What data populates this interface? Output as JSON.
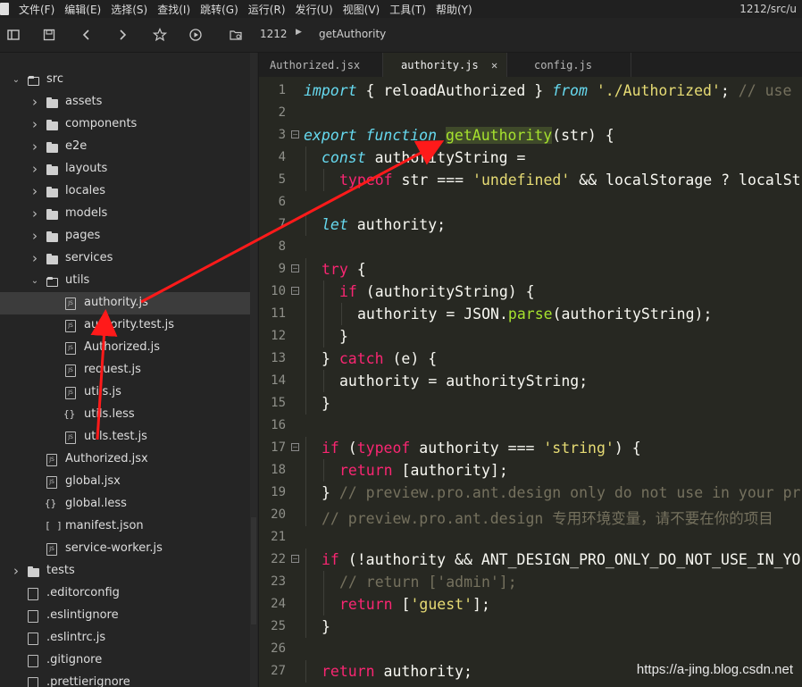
{
  "menubar": {
    "items": [
      "文件(F)",
      "编辑(E)",
      "选择(S)",
      "查找(I)",
      "跳转(G)",
      "运行(R)",
      "发行(U)",
      "视图(V)",
      "工具(T)",
      "帮助(Y)"
    ],
    "title_path": "1212/src/u"
  },
  "toolbar": {
    "project": "1212",
    "breadcrumb": "getAuthority"
  },
  "sidebar": {
    "items": [
      {
        "label": "src",
        "type": "folder-open"
      },
      {
        "label": "assets",
        "type": "folder"
      },
      {
        "label": "components",
        "type": "folder"
      },
      {
        "label": "e2e",
        "type": "folder"
      },
      {
        "label": "layouts",
        "type": "folder"
      },
      {
        "label": "locales",
        "type": "folder"
      },
      {
        "label": "models",
        "type": "folder"
      },
      {
        "label": "pages",
        "type": "folder"
      },
      {
        "label": "services",
        "type": "folder"
      },
      {
        "label": "utils",
        "type": "folder-open"
      },
      {
        "label": "authority.js",
        "type": "js"
      },
      {
        "label": "authority.test.js",
        "type": "js"
      },
      {
        "label": "Authorized.js",
        "type": "js"
      },
      {
        "label": "request.js",
        "type": "js"
      },
      {
        "label": "utils.js",
        "type": "js"
      },
      {
        "label": "utils.less",
        "type": "less"
      },
      {
        "label": "utils.test.js",
        "type": "js"
      },
      {
        "label": "Authorized.jsx",
        "type": "js"
      },
      {
        "label": "global.jsx",
        "type": "js"
      },
      {
        "label": "global.less",
        "type": "less"
      },
      {
        "label": "manifest.json",
        "type": "json"
      },
      {
        "label": "service-worker.js",
        "type": "js"
      },
      {
        "label": "tests",
        "type": "folder"
      },
      {
        "label": ".editorconfig",
        "type": "file"
      },
      {
        "label": ".eslintignore",
        "type": "file"
      },
      {
        "label": ".eslintrc.js",
        "type": "file"
      },
      {
        "label": ".gitignore",
        "type": "file"
      },
      {
        "label": ".prettierignore",
        "type": "file"
      }
    ]
  },
  "tabs": [
    {
      "label": "Authorized.jsx"
    },
    {
      "label": "authority.js"
    },
    {
      "label": "config.js"
    }
  ],
  "tab_close": "✕",
  "editor": {
    "line_numbers": [
      "1",
      "2",
      "3",
      "4",
      "5",
      "6",
      "7",
      "8",
      "9",
      "10",
      "11",
      "12",
      "13",
      "14",
      "15",
      "16",
      "17",
      "18",
      "19",
      "20",
      "21",
      "22",
      "23",
      "24",
      "25",
      "26",
      "27"
    ],
    "lines": [
      {
        "indent": 0,
        "tokens": [
          [
            "st",
            "import"
          ],
          [
            "p",
            " { reloadAuthorized } "
          ],
          [
            "st",
            "from"
          ],
          [
            "p",
            " "
          ],
          [
            "str",
            "'./Authorized'"
          ],
          [
            "p",
            "; "
          ],
          [
            "cm",
            "// use"
          ]
        ]
      },
      {
        "indent": 0,
        "tokens": []
      },
      {
        "indent": 0,
        "tokens": [
          [
            "st",
            "export"
          ],
          [
            "p",
            " "
          ],
          [
            "st",
            "function"
          ],
          [
            "p",
            " "
          ],
          [
            "hl",
            "getAuthority"
          ],
          [
            "p",
            "(str) {"
          ]
        ]
      },
      {
        "indent": 1,
        "tokens": [
          [
            "st",
            "const"
          ],
          [
            "p",
            " authorityString ="
          ]
        ]
      },
      {
        "indent": 2,
        "tokens": [
          [
            "kw",
            "typeof"
          ],
          [
            "p",
            " str === "
          ],
          [
            "str",
            "'undefined'"
          ],
          [
            "p",
            " && localStorage ? localSt"
          ]
        ]
      },
      {
        "indent": 0,
        "tokens": []
      },
      {
        "indent": 1,
        "tokens": [
          [
            "st",
            "let"
          ],
          [
            "p",
            " authority;"
          ]
        ]
      },
      {
        "indent": 0,
        "tokens": []
      },
      {
        "indent": 1,
        "tokens": [
          [
            "kw",
            "try"
          ],
          [
            "p",
            " {"
          ]
        ]
      },
      {
        "indent": 2,
        "tokens": [
          [
            "kw",
            "if"
          ],
          [
            "p",
            " (authorityString) {"
          ]
        ]
      },
      {
        "indent": 3,
        "tokens": [
          [
            "p",
            "authority = JSON."
          ],
          [
            "fn",
            "parse"
          ],
          [
            "p",
            "(authorityString);"
          ]
        ]
      },
      {
        "indent": 2,
        "tokens": [
          [
            "p",
            "}"
          ]
        ]
      },
      {
        "indent": 1,
        "tokens": [
          [
            "p",
            "} "
          ],
          [
            "kw",
            "catch"
          ],
          [
            "p",
            " (e) {"
          ]
        ]
      },
      {
        "indent": 2,
        "tokens": [
          [
            "p",
            "authority = authorityString;"
          ]
        ]
      },
      {
        "indent": 1,
        "tokens": [
          [
            "p",
            "}"
          ]
        ]
      },
      {
        "indent": 0,
        "tokens": []
      },
      {
        "indent": 1,
        "tokens": [
          [
            "kw",
            "if"
          ],
          [
            "p",
            " ("
          ],
          [
            "kw",
            "typeof"
          ],
          [
            "p",
            " authority === "
          ],
          [
            "str",
            "'string'"
          ],
          [
            "p",
            ") {"
          ]
        ]
      },
      {
        "indent": 2,
        "tokens": [
          [
            "kw",
            "return"
          ],
          [
            "p",
            " [authority];"
          ]
        ]
      },
      {
        "indent": 1,
        "tokens": [
          [
            "p",
            "} "
          ],
          [
            "cm",
            "// preview.pro.ant.design only do not use in your pr"
          ]
        ]
      },
      {
        "indent": 1,
        "tokens": [
          [
            "cm",
            "// preview.pro.ant.design 专用环境变量，请不要在你的项目"
          ]
        ]
      },
      {
        "indent": 0,
        "tokens": []
      },
      {
        "indent": 1,
        "tokens": [
          [
            "kw",
            "if"
          ],
          [
            "p",
            " (!authority && ANT_DESIGN_PRO_ONLY_DO_NOT_USE_IN_YO"
          ]
        ]
      },
      {
        "indent": 2,
        "tokens": [
          [
            "cm",
            "// return ['admin'];"
          ]
        ]
      },
      {
        "indent": 2,
        "tokens": [
          [
            "kw",
            "return"
          ],
          [
            "p",
            " ["
          ],
          [
            "str",
            "'guest'"
          ],
          [
            "p",
            "];"
          ]
        ]
      },
      {
        "indent": 1,
        "tokens": [
          [
            "p",
            "}"
          ]
        ]
      },
      {
        "indent": 0,
        "tokens": []
      },
      {
        "indent": 1,
        "tokens": [
          [
            "kw",
            "return"
          ],
          [
            "p",
            " authority;"
          ]
        ]
      }
    ],
    "fold_lines": [
      3,
      9,
      10,
      17,
      22
    ]
  },
  "watermark": "https://a-jing.blog.csdn.net",
  "colors": {
    "arrow": "#ff1a1a",
    "keyword": "#f92672",
    "storage": "#66d9ef",
    "string": "#e6db74",
    "function": "#a6e22e",
    "comment": "#75715e"
  }
}
